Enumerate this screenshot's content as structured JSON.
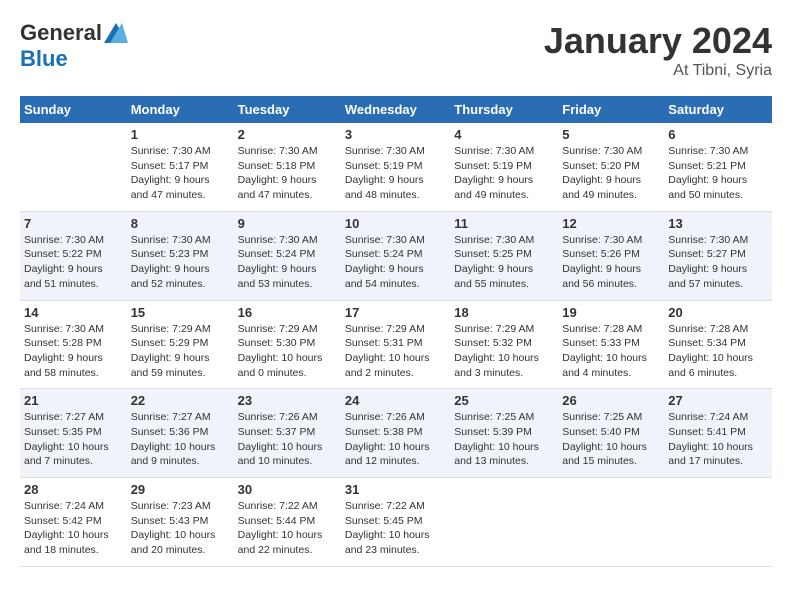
{
  "logo": {
    "general": "General",
    "blue": "Blue"
  },
  "title": "January 2024",
  "subtitle": "At Tibni, Syria",
  "days_header": [
    "Sunday",
    "Monday",
    "Tuesday",
    "Wednesday",
    "Thursday",
    "Friday",
    "Saturday"
  ],
  "weeks": [
    [
      {
        "day": "",
        "info": ""
      },
      {
        "day": "1",
        "info": "Sunrise: 7:30 AM\nSunset: 5:17 PM\nDaylight: 9 hours\nand 47 minutes."
      },
      {
        "day": "2",
        "info": "Sunrise: 7:30 AM\nSunset: 5:18 PM\nDaylight: 9 hours\nand 47 minutes."
      },
      {
        "day": "3",
        "info": "Sunrise: 7:30 AM\nSunset: 5:19 PM\nDaylight: 9 hours\nand 48 minutes."
      },
      {
        "day": "4",
        "info": "Sunrise: 7:30 AM\nSunset: 5:19 PM\nDaylight: 9 hours\nand 49 minutes."
      },
      {
        "day": "5",
        "info": "Sunrise: 7:30 AM\nSunset: 5:20 PM\nDaylight: 9 hours\nand 49 minutes."
      },
      {
        "day": "6",
        "info": "Sunrise: 7:30 AM\nSunset: 5:21 PM\nDaylight: 9 hours\nand 50 minutes."
      }
    ],
    [
      {
        "day": "7",
        "info": "Sunrise: 7:30 AM\nSunset: 5:22 PM\nDaylight: 9 hours\nand 51 minutes."
      },
      {
        "day": "8",
        "info": "Sunrise: 7:30 AM\nSunset: 5:23 PM\nDaylight: 9 hours\nand 52 minutes."
      },
      {
        "day": "9",
        "info": "Sunrise: 7:30 AM\nSunset: 5:24 PM\nDaylight: 9 hours\nand 53 minutes."
      },
      {
        "day": "10",
        "info": "Sunrise: 7:30 AM\nSunset: 5:24 PM\nDaylight: 9 hours\nand 54 minutes."
      },
      {
        "day": "11",
        "info": "Sunrise: 7:30 AM\nSunset: 5:25 PM\nDaylight: 9 hours\nand 55 minutes."
      },
      {
        "day": "12",
        "info": "Sunrise: 7:30 AM\nSunset: 5:26 PM\nDaylight: 9 hours\nand 56 minutes."
      },
      {
        "day": "13",
        "info": "Sunrise: 7:30 AM\nSunset: 5:27 PM\nDaylight: 9 hours\nand 57 minutes."
      }
    ],
    [
      {
        "day": "14",
        "info": "Sunrise: 7:30 AM\nSunset: 5:28 PM\nDaylight: 9 hours\nand 58 minutes."
      },
      {
        "day": "15",
        "info": "Sunrise: 7:29 AM\nSunset: 5:29 PM\nDaylight: 9 hours\nand 59 minutes."
      },
      {
        "day": "16",
        "info": "Sunrise: 7:29 AM\nSunset: 5:30 PM\nDaylight: 10 hours\nand 0 minutes."
      },
      {
        "day": "17",
        "info": "Sunrise: 7:29 AM\nSunset: 5:31 PM\nDaylight: 10 hours\nand 2 minutes."
      },
      {
        "day": "18",
        "info": "Sunrise: 7:29 AM\nSunset: 5:32 PM\nDaylight: 10 hours\nand 3 minutes."
      },
      {
        "day": "19",
        "info": "Sunrise: 7:28 AM\nSunset: 5:33 PM\nDaylight: 10 hours\nand 4 minutes."
      },
      {
        "day": "20",
        "info": "Sunrise: 7:28 AM\nSunset: 5:34 PM\nDaylight: 10 hours\nand 6 minutes."
      }
    ],
    [
      {
        "day": "21",
        "info": "Sunrise: 7:27 AM\nSunset: 5:35 PM\nDaylight: 10 hours\nand 7 minutes."
      },
      {
        "day": "22",
        "info": "Sunrise: 7:27 AM\nSunset: 5:36 PM\nDaylight: 10 hours\nand 9 minutes."
      },
      {
        "day": "23",
        "info": "Sunrise: 7:26 AM\nSunset: 5:37 PM\nDaylight: 10 hours\nand 10 minutes."
      },
      {
        "day": "24",
        "info": "Sunrise: 7:26 AM\nSunset: 5:38 PM\nDaylight: 10 hours\nand 12 minutes."
      },
      {
        "day": "25",
        "info": "Sunrise: 7:25 AM\nSunset: 5:39 PM\nDaylight: 10 hours\nand 13 minutes."
      },
      {
        "day": "26",
        "info": "Sunrise: 7:25 AM\nSunset: 5:40 PM\nDaylight: 10 hours\nand 15 minutes."
      },
      {
        "day": "27",
        "info": "Sunrise: 7:24 AM\nSunset: 5:41 PM\nDaylight: 10 hours\nand 17 minutes."
      }
    ],
    [
      {
        "day": "28",
        "info": "Sunrise: 7:24 AM\nSunset: 5:42 PM\nDaylight: 10 hours\nand 18 minutes."
      },
      {
        "day": "29",
        "info": "Sunrise: 7:23 AM\nSunset: 5:43 PM\nDaylight: 10 hours\nand 20 minutes."
      },
      {
        "day": "30",
        "info": "Sunrise: 7:22 AM\nSunset: 5:44 PM\nDaylight: 10 hours\nand 22 minutes."
      },
      {
        "day": "31",
        "info": "Sunrise: 7:22 AM\nSunset: 5:45 PM\nDaylight: 10 hours\nand 23 minutes."
      },
      {
        "day": "",
        "info": ""
      },
      {
        "day": "",
        "info": ""
      },
      {
        "day": "",
        "info": ""
      }
    ]
  ]
}
